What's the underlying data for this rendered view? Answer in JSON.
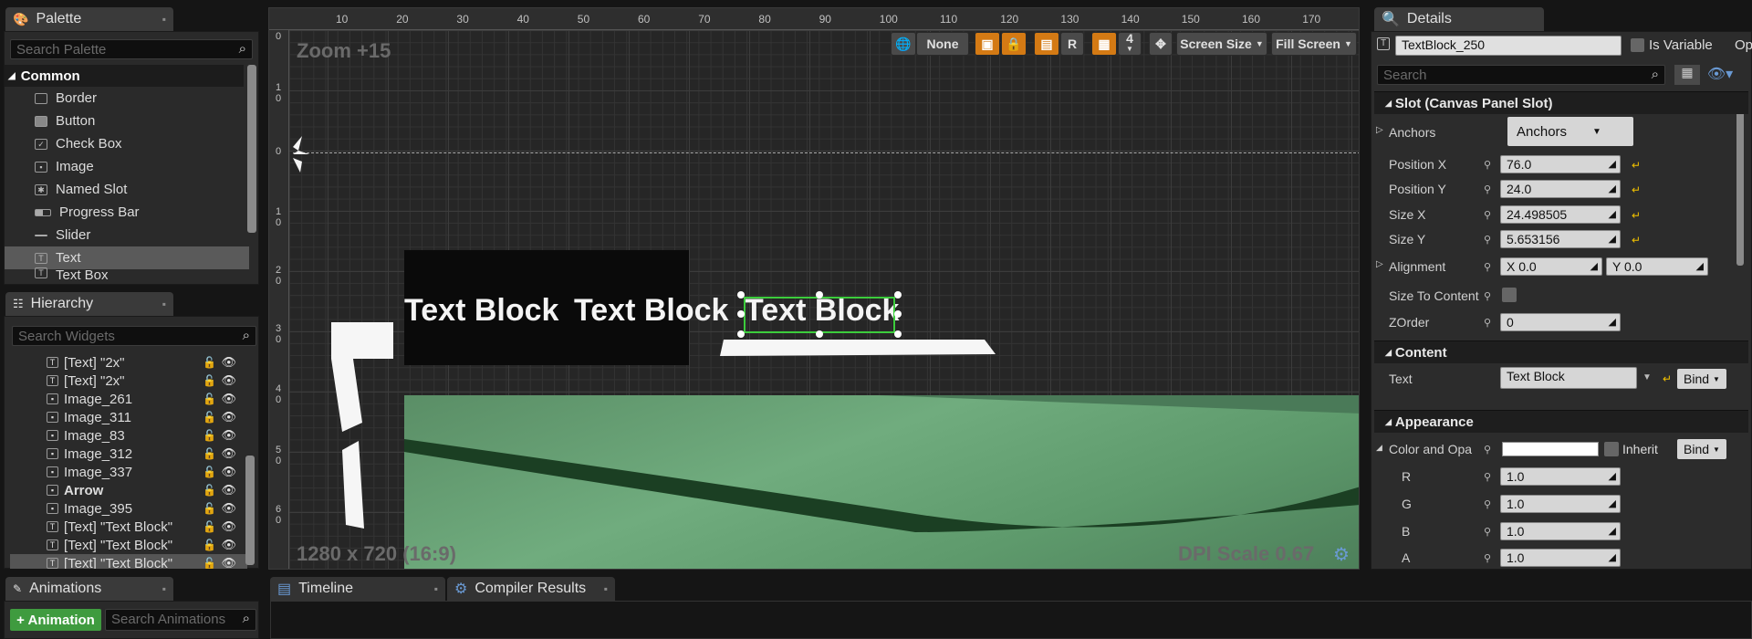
{
  "palette": {
    "title": "Palette",
    "search_placeholder": "Search Palette",
    "category": "Common",
    "items": [
      "Border",
      "Button",
      "Check Box",
      "Image",
      "Named Slot",
      "Progress Bar",
      "Slider",
      "Text",
      "Text Box"
    ],
    "selected_item": "Text"
  },
  "hierarchy": {
    "title": "Hierarchy",
    "search_placeholder": "Search Widgets",
    "items": [
      "[Text] \"2x\"",
      "[Text] \"2x\"",
      "Image_261",
      "Image_311",
      "Image_83",
      "Image_312",
      "Image_337",
      "Arrow",
      "Image_395",
      "[Text] \"Text Block\"",
      "[Text] \"Text Block\"",
      "[Text] \"Text Block\""
    ]
  },
  "designer": {
    "zoom": "Zoom +15",
    "resolution": "1280 x 720 (16:9)",
    "dpi": "DPI Scale 0.67",
    "ruler": [
      "10",
      "20",
      "30",
      "40",
      "50",
      "60",
      "70",
      "80",
      "90",
      "100",
      "110",
      "120",
      "130",
      "140",
      "150",
      "160",
      "170"
    ],
    "vruler": [
      "0",
      "1 0",
      "0",
      "1 0",
      "2 0",
      "3 0",
      "4 0",
      "5 0",
      "6 0"
    ],
    "toolbar": {
      "none_label": "None",
      "r_label": "R",
      "grid_num": "4",
      "screen_size": "Screen Size",
      "fill_screen": "Fill Screen"
    },
    "text_blocks": [
      "Text Block",
      "Text Block",
      "Text Block"
    ]
  },
  "details": {
    "title": "Details",
    "widget_name": "TextBlock_250",
    "is_variable_label": "Is Variable",
    "extra_tab": "Op",
    "search_placeholder": "Search",
    "slot_section": "Slot (Canvas Panel Slot)",
    "anchors_label": "Anchors",
    "anchors_value": "Anchors",
    "position_x_label": "Position X",
    "position_x": "76.0",
    "position_y_label": "Position Y",
    "position_y": "24.0",
    "size_x_label": "Size X",
    "size_x": "24.498505",
    "size_y_label": "Size Y",
    "size_y": "5.653156",
    "alignment_label": "Alignment",
    "alignment_x": "X  0.0",
    "alignment_y": "Y  0.0",
    "size_to_content_label": "Size To Content",
    "zorder_label": "ZOrder",
    "zorder": "0",
    "content_section": "Content",
    "text_label": "Text",
    "text_value": "Text Block",
    "bind_label": "Bind",
    "appearance_section": "Appearance",
    "color_label": "Color and Opa",
    "inherit_label": "Inherit",
    "r_label": "R",
    "r": "1.0",
    "g_label": "G",
    "g": "1.0",
    "b_label": "B",
    "b": "1.0",
    "a_label": "A",
    "a": "1.0"
  },
  "animations": {
    "title": "Animations",
    "add_button": "+ Animation",
    "search_placeholder": "Search Animations"
  },
  "bottom_tabs": [
    "Timeline",
    "Compiler Results"
  ],
  "colors": {
    "accent_orange": "#d47a14",
    "selection_green": "#3ccc3c",
    "add_green": "#3f9b3f",
    "canvas_bg": "#2a2a2a",
    "scene_green": "#6aa97a"
  }
}
